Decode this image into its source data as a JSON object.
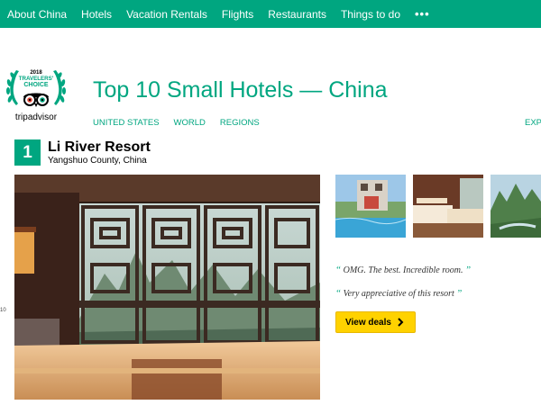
{
  "nav": {
    "items": [
      {
        "label": "About China"
      },
      {
        "label": "Hotels"
      },
      {
        "label": "Vacation Rentals"
      },
      {
        "label": "Flights"
      },
      {
        "label": "Restaurants"
      },
      {
        "label": "Things to do"
      }
    ],
    "more_label": "•••"
  },
  "badge": {
    "year": "2018",
    "line1": "TRAVELERS'",
    "line2": "CHOICE",
    "brand": "tripadvisor"
  },
  "page_title": "Top 10 Small Hotels — China",
  "subnav": {
    "items": [
      "UNITED STATES",
      "WORLD",
      "REGIONS"
    ],
    "expand": "EXPA"
  },
  "hotel": {
    "rank": "1",
    "name": "Li River Resort",
    "location": "Yangshuo County, China"
  },
  "quotes": [
    {
      "text": "OMG. The best. Incredible room."
    },
    {
      "text": "Very appreciative of this resort"
    }
  ],
  "deals_button": {
    "label": "View deals"
  },
  "side_number": "10",
  "colors": {
    "brand_green": "#00a680",
    "button_yellow": "#ffd200"
  }
}
